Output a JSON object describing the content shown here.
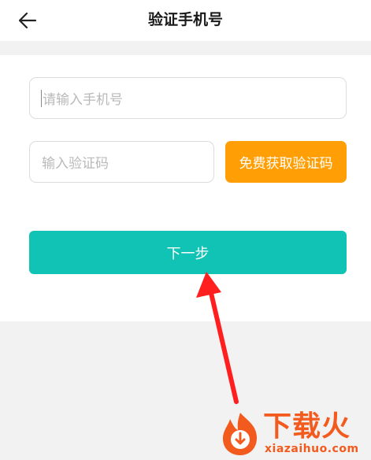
{
  "header": {
    "title": "验证手机号",
    "back_icon": "arrow-left-icon"
  },
  "form": {
    "phone_placeholder": "请输入手机号",
    "code_placeholder": "输入验证码",
    "get_code_label": "免费获取验证码",
    "next_label": "下一步"
  },
  "watermark": {
    "brand": "下载火",
    "site": "xiazaihuo.com"
  },
  "colors": {
    "accent": "#11c3b4",
    "code_button": "#ff9f05",
    "annotation_arrow": "#ff1f1f",
    "watermark": "#f25a1e"
  }
}
